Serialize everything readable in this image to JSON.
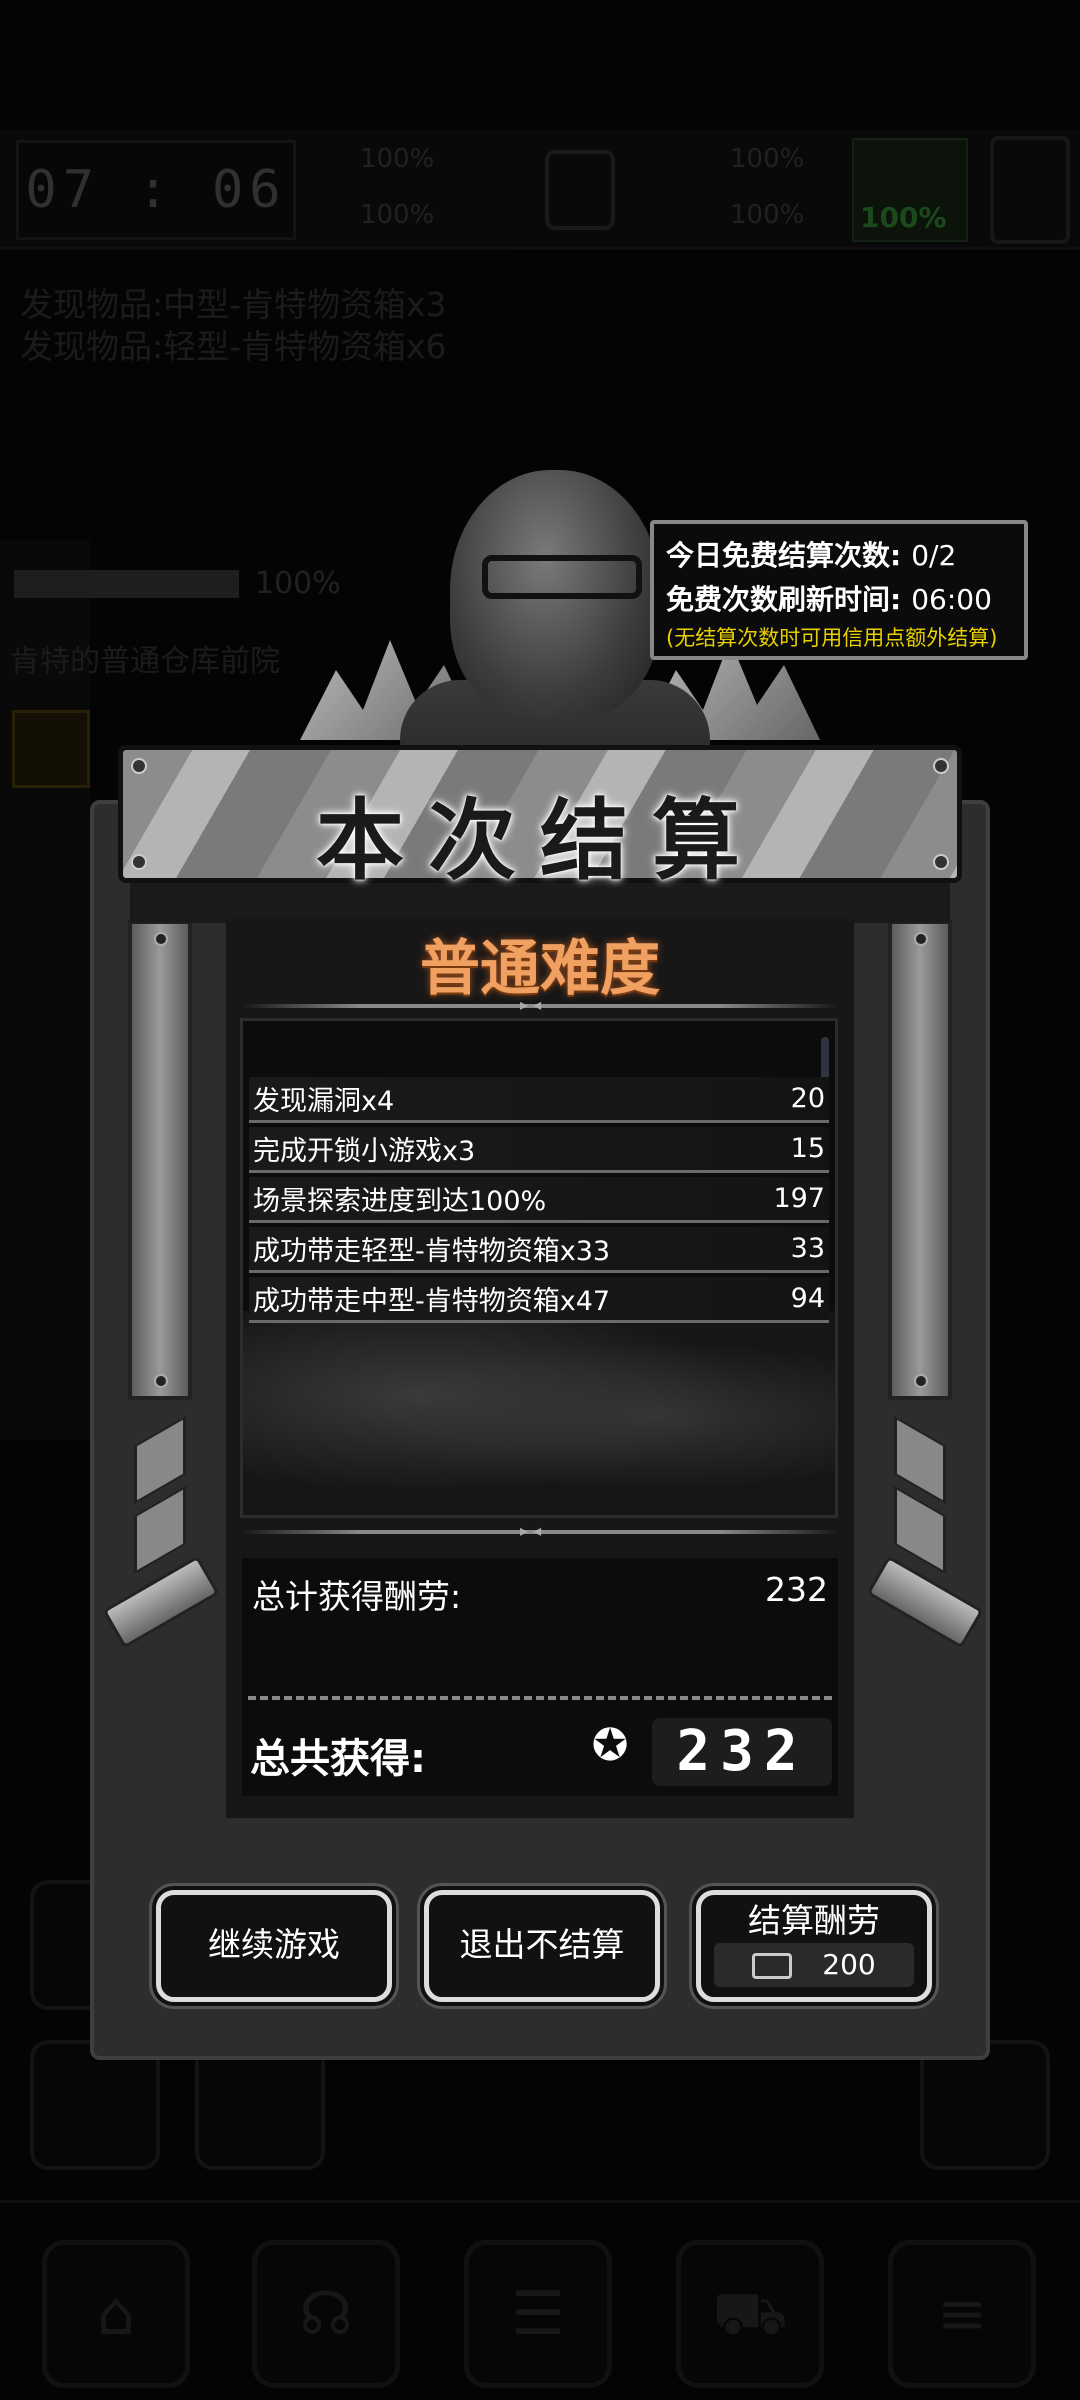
{
  "hud": {
    "clock": "07 : 06",
    "stats": [
      "100%",
      "100%",
      "100%",
      "100%"
    ],
    "green_percent": "100%"
  },
  "background": {
    "found_items": [
      "发现物品:中型-肯特物资箱x3",
      "发现物品:轻型-肯特物资箱x6"
    ],
    "progress_percent": "100%",
    "location": "肯特的普通仓库前院"
  },
  "info": {
    "free_settle_label": "今日免费结算次数:",
    "free_settle_value": "0/2",
    "refresh_label": "免费次数刷新时间:",
    "refresh_value": "06:00",
    "note": "(无结算次数时可用信用点额外结算)"
  },
  "settlement": {
    "title": "本次结算",
    "difficulty": "普通难度",
    "rows": [
      {
        "label": "发现漏洞x4",
        "value": "20"
      },
      {
        "label": "完成开锁小游戏x3",
        "value": "15"
      },
      {
        "label": "场景探索进度到达100%",
        "value": "197"
      },
      {
        "label": "成功带走轻型-肯特物资箱x33",
        "value": "33"
      },
      {
        "label": "成功带走中型-肯特物资箱x47",
        "value": "94"
      }
    ],
    "total_label": "总计获得酬劳:",
    "total_value": "232",
    "grand_label": "总共获得:",
    "grand_value": "232"
  },
  "buttons": {
    "continue": "继续游戏",
    "exit": "退出不结算",
    "settle": "结算酬劳",
    "settle_cost": "200"
  },
  "colors": {
    "difficulty": "#f0a060",
    "note": "#e8d000",
    "panel": "#2d2d2d"
  }
}
